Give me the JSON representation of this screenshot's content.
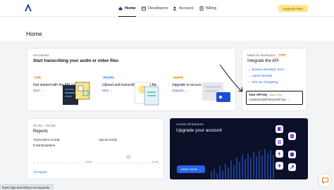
{
  "nav": {
    "home": "Home",
    "developers": "Developers",
    "account": "Account",
    "billing": "Billing",
    "upgrade": "Upgrade Plan"
  },
  "page": {
    "title": "Home"
  },
  "get_started": {
    "eyebrow": "Get started",
    "title": "Start transcribing your audio or video files",
    "steps": [
      {
        "badge": "Code",
        "title": "Get started with the API quickstart",
        "link": "Start →"
      },
      {
        "badge": "No-code",
        "title": "Upload and transcribe an audio file",
        "link": "Start →"
      },
      {
        "badge": "Upgrade",
        "title": "Upgrade to access all features",
        "link": "Upgrade →"
      }
    ]
  },
  "developers": {
    "eyebrow": "Made for developers",
    "badge": "Code",
    "title": "Integrate the API",
    "links": [
      "Browse developer docs",
      "Latest tutorials",
      "See our changelog"
    ],
    "api_key_label": "Your API key",
    "api_key_hint": "Basic Plan",
    "api_key_value": "c2d8263309f554449f44e..."
  },
  "reports": {
    "range": "30 Jan – 06 Feb",
    "title": "Reports",
    "transcription_label": "Transcription activity",
    "transcription_value": "0 transcriptions",
    "spend_label": "Spend activity",
    "axis_label": "Today",
    "all_reports": "All reports"
  },
  "upgrade_card": {
    "eyebrow": "Access all features",
    "title": "Upgrade your account",
    "button": "Learn more →"
  },
  "statusbar": {
    "url": "https://app.assemblyai.com/upgrade"
  }
}
